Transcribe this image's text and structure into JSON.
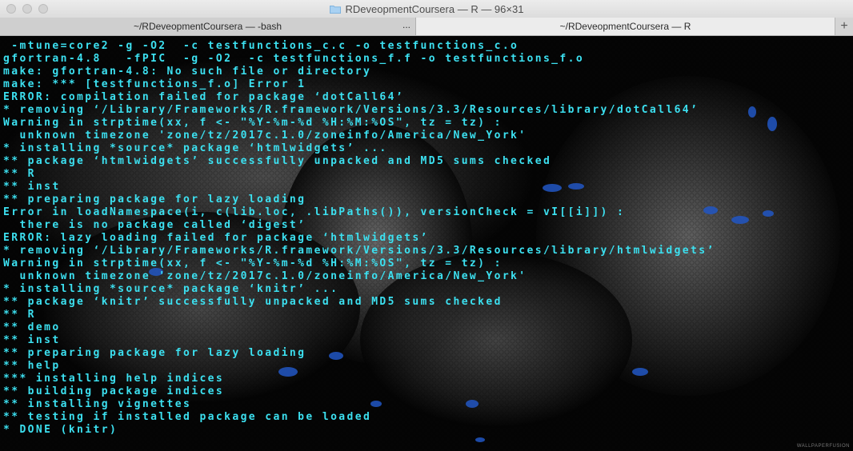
{
  "window": {
    "title": "RDeveopmentCoursera — R — 96×31"
  },
  "tabs": [
    {
      "label": "~/RDeveopmentCoursera — -bash",
      "active": false
    },
    {
      "label": "~/RDeveopmentCoursera — R",
      "active": true
    }
  ],
  "tab_overflow": "...",
  "tab_add": "+",
  "terminal": {
    "lines": [
      " -mtune=core2 -g -O2  -c testfunctions_c.c -o testfunctions_c.o",
      "gfortran-4.8   -fPIC  -g -O2  -c testfunctions_f.f -o testfunctions_f.o",
      "make: gfortran-4.8: No such file or directory",
      "make: *** [testfunctions_f.o] Error 1",
      "ERROR: compilation failed for package ‘dotCall64’",
      "* removing ‘/Library/Frameworks/R.framework/Versions/3.3/Resources/library/dotCall64’",
      "Warning in strptime(xx, f <- \"%Y-%m-%d %H:%M:%OS\", tz = tz) :",
      "  unknown timezone 'zone/tz/2017c.1.0/zoneinfo/America/New_York'",
      "* installing *source* package ‘htmlwidgets’ ...",
      "** package ‘htmlwidgets’ successfully unpacked and MD5 sums checked",
      "** R",
      "** inst",
      "** preparing package for lazy loading",
      "Error in loadNamespace(i, c(lib.loc, .libPaths()), versionCheck = vI[[i]]) :",
      "  there is no package called ‘digest’",
      "ERROR: lazy loading failed for package ‘htmlwidgets’",
      "* removing ‘/Library/Frameworks/R.framework/Versions/3.3/Resources/library/htmlwidgets’",
      "Warning in strptime(xx, f <- \"%Y-%m-%d %H:%M:%OS\", tz = tz) :",
      "  unknown timezone 'zone/tz/2017c.1.0/zoneinfo/America/New_York'",
      "* installing *source* package ‘knitr’ ...",
      "** package ‘knitr’ successfully unpacked and MD5 sums checked",
      "** R",
      "** demo",
      "** inst",
      "** preparing package for lazy loading",
      "** help",
      "*** installing help indices",
      "** building package indices",
      "** installing vignettes",
      "** testing if installed package can be loaded",
      "* DONE (knitr)"
    ],
    "text_color": "#3ce0f0"
  },
  "watermark": "WALLPAPERFUSION",
  "icons": {
    "title": "folder-icon",
    "new_tab": "plus-icon"
  }
}
